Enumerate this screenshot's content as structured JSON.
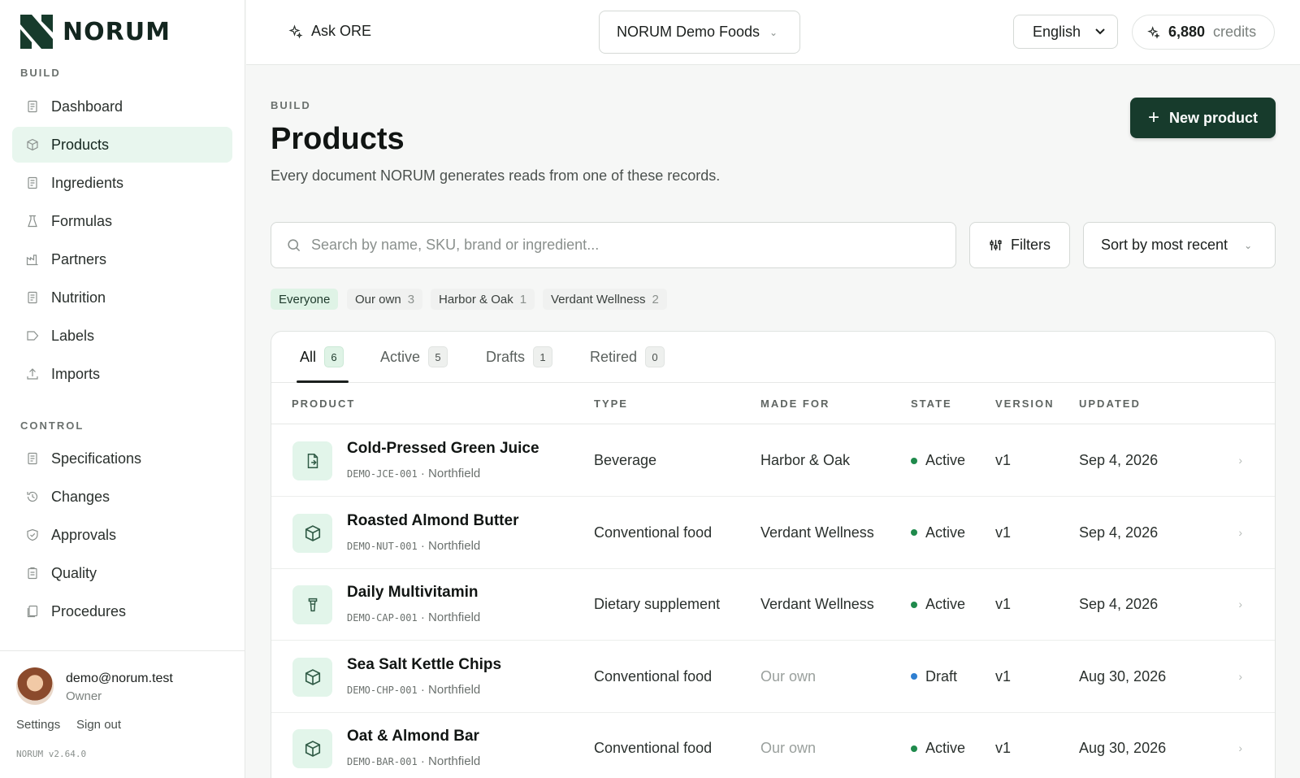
{
  "brand": {
    "name": "NORUM",
    "accent": "#173b2c",
    "highlight": "#e8f6ee"
  },
  "sidebar": {
    "build_label": "BUILD",
    "build_items": [
      {
        "label": "Dashboard",
        "icon": "document-icon"
      },
      {
        "label": "Products",
        "icon": "box-icon",
        "active": true
      },
      {
        "label": "Ingredients",
        "icon": "document-icon"
      },
      {
        "label": "Formulas",
        "icon": "flask-icon"
      },
      {
        "label": "Partners",
        "icon": "factory-icon"
      },
      {
        "label": "Nutrition",
        "icon": "document-icon"
      },
      {
        "label": "Labels",
        "icon": "tag-icon"
      },
      {
        "label": "Imports",
        "icon": "upload-icon"
      }
    ],
    "control_label": "CONTROL",
    "control_items": [
      {
        "label": "Specifications",
        "icon": "document-icon"
      },
      {
        "label": "Changes",
        "icon": "history-icon"
      },
      {
        "label": "Approvals",
        "icon": "shield-check-icon"
      },
      {
        "label": "Quality",
        "icon": "clipboard-icon"
      },
      {
        "label": "Procedures",
        "icon": "pages-icon"
      }
    ],
    "user": {
      "email": "demo@norum.test",
      "role": "Owner"
    },
    "settings_label": "Settings",
    "signout_label": "Sign out",
    "version": "NORUM v2.64.0"
  },
  "topbar": {
    "ask_label": "Ask ORE",
    "org_name": "NORUM Demo Foods",
    "language": "English",
    "credits_value": "6,880",
    "credits_unit": "credits"
  },
  "page": {
    "eyebrow": "BUILD",
    "title": "Products",
    "subtitle": "Every document NORUM generates reads from one of these records.",
    "new_button": "New product",
    "search_placeholder": "Search by name, SKU, brand or ingredient...",
    "filters_label": "Filters",
    "sort_label": "Sort by most recent"
  },
  "chips": [
    {
      "label": "Everyone",
      "count": "",
      "active": true
    },
    {
      "label": "Our own",
      "count": "3"
    },
    {
      "label": "Harbor & Oak",
      "count": "1"
    },
    {
      "label": "Verdant Wellness",
      "count": "2"
    }
  ],
  "tabs": [
    {
      "label": "All",
      "count": "6",
      "active": true
    },
    {
      "label": "Active",
      "count": "5"
    },
    {
      "label": "Drafts",
      "count": "1"
    },
    {
      "label": "Retired",
      "count": "0"
    }
  ],
  "table": {
    "headers": [
      "PRODUCT",
      "TYPE",
      "MADE FOR",
      "STATE",
      "VERSION",
      "UPDATED"
    ],
    "rows": [
      {
        "name": "Cold-Pressed Green Juice",
        "sku": "DEMO-JCE-001",
        "site": "Northfield",
        "type": "Beverage",
        "made_for": "Harbor & Oak",
        "made_for_muted": false,
        "state": "Active",
        "state_color": "#1f8a4c",
        "version": "v1",
        "updated": "Sep 4, 2026",
        "icon": "juice-icon"
      },
      {
        "name": "Roasted Almond Butter",
        "sku": "DEMO-NUT-001",
        "site": "Northfield",
        "type": "Conventional food",
        "made_for": "Verdant Wellness",
        "made_for_muted": false,
        "state": "Active",
        "state_color": "#1f8a4c",
        "version": "v1",
        "updated": "Sep 4, 2026",
        "icon": "box-icon"
      },
      {
        "name": "Daily Multivitamin",
        "sku": "DEMO-CAP-001",
        "site": "Northfield",
        "type": "Dietary supplement",
        "made_for": "Verdant Wellness",
        "made_for_muted": false,
        "state": "Active",
        "state_color": "#1f8a4c",
        "version": "v1",
        "updated": "Sep 4, 2026",
        "icon": "bottle-icon"
      },
      {
        "name": "Sea Salt Kettle Chips",
        "sku": "DEMO-CHP-001",
        "site": "Northfield",
        "type": "Conventional food",
        "made_for": "Our own",
        "made_for_muted": true,
        "state": "Draft",
        "state_color": "#2f7fd1",
        "version": "v1",
        "updated": "Aug 30, 2026",
        "icon": "box-icon"
      },
      {
        "name": "Oat & Almond Bar",
        "sku": "DEMO-BAR-001",
        "site": "Northfield",
        "type": "Conventional food",
        "made_for": "Our own",
        "made_for_muted": true,
        "state": "Active",
        "state_color": "#1f8a4c",
        "version": "v1",
        "updated": "Aug 30, 2026",
        "icon": "box-icon"
      }
    ]
  }
}
